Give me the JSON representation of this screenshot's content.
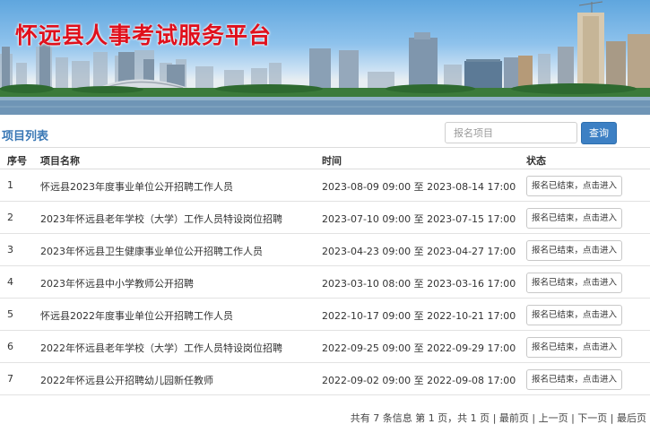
{
  "banner": {
    "title": "怀远县人事考试服务平台"
  },
  "toolbar": {
    "section_title": "项目列表",
    "search_placeholder": "报名项目",
    "search_label": "查询"
  },
  "table": {
    "headers": {
      "no": "序号",
      "name": "项目名称",
      "time": "时间",
      "status": "状态"
    },
    "rows": [
      {
        "no": "1",
        "name": "怀远县2023年度事业单位公开招聘工作人员",
        "time": "2023-08-09 09:00 至 2023-08-14 17:00",
        "status": "报名已结束，点击进入"
      },
      {
        "no": "2",
        "name": "2023年怀远县老年学校（大学）工作人员特设岗位招聘",
        "time": "2023-07-10 09:00 至 2023-07-15 17:00",
        "status": "报名已结束，点击进入"
      },
      {
        "no": "3",
        "name": "2023年怀远县卫生健康事业单位公开招聘工作人员",
        "time": "2023-04-23 09:00 至 2023-04-27 17:00",
        "status": "报名已结束，点击进入"
      },
      {
        "no": "4",
        "name": "2023年怀远县中小学教师公开招聘",
        "time": "2023-03-10 08:00 至 2023-03-16 17:00",
        "status": "报名已结束，点击进入"
      },
      {
        "no": "5",
        "name": "怀远县2022年度事业单位公开招聘工作人员",
        "time": "2022-10-17 09:00 至 2022-10-21 17:00",
        "status": "报名已结束，点击进入"
      },
      {
        "no": "6",
        "name": "2022年怀远县老年学校（大学）工作人员特设岗位招聘",
        "time": "2022-09-25 09:00 至 2022-09-29 17:00",
        "status": "报名已结束，点击进入"
      },
      {
        "no": "7",
        "name": "2022年怀远县公开招聘幼儿园新任教师",
        "time": "2022-09-02 09:00 至 2022-09-08 17:00",
        "status": "报名已结束，点击进入"
      }
    ]
  },
  "pager": {
    "summary": "共有 7 条信息 第 1 页，共 1 页",
    "first": "最前页",
    "prev": "上一页",
    "next": "下一页",
    "last": "最后页"
  }
}
